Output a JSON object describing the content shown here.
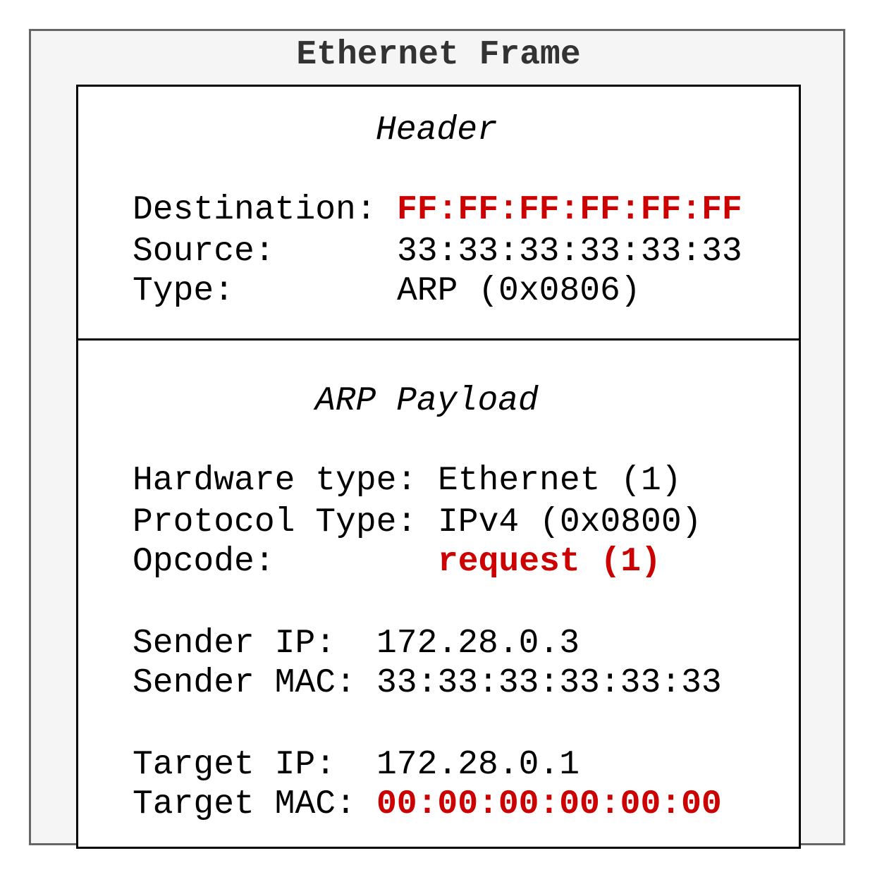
{
  "frame": {
    "title": "Ethernet Frame"
  },
  "header": {
    "title": "Header",
    "fields": [
      {
        "label": "Destination:",
        "value": "FF:FF:FF:FF:FF:FF",
        "highlight": true
      },
      {
        "label": "Source:",
        "value": "33:33:33:33:33:33",
        "highlight": false
      },
      {
        "label": "Type:",
        "value": "ARP (0x0806)",
        "highlight": false
      }
    ]
  },
  "payload": {
    "title": "ARP Payload",
    "fields": [
      {
        "label": "Hardware type:",
        "value": "Ethernet (1)",
        "highlight": false
      },
      {
        "label": "Protocol Type:",
        "value": "IPv4 (0x0800)",
        "highlight": false
      },
      {
        "label": "Opcode:",
        "value": "request (1)",
        "highlight": true
      },
      {
        "label": "Sender IP:",
        "value": "172.28.0.3",
        "highlight": false
      },
      {
        "label": "Sender MAC:",
        "value": "33:33:33:33:33:33",
        "highlight": false
      },
      {
        "label": "Target IP:",
        "value": "172.28.0.1",
        "highlight": false
      },
      {
        "label": "Target MAC:",
        "value": "00:00:00:00:00:00",
        "highlight": true
      }
    ]
  },
  "colors": {
    "highlight": "#cc0000",
    "frame_border": "#666666",
    "frame_fill": "#f5f5f5",
    "title": "#333333"
  }
}
